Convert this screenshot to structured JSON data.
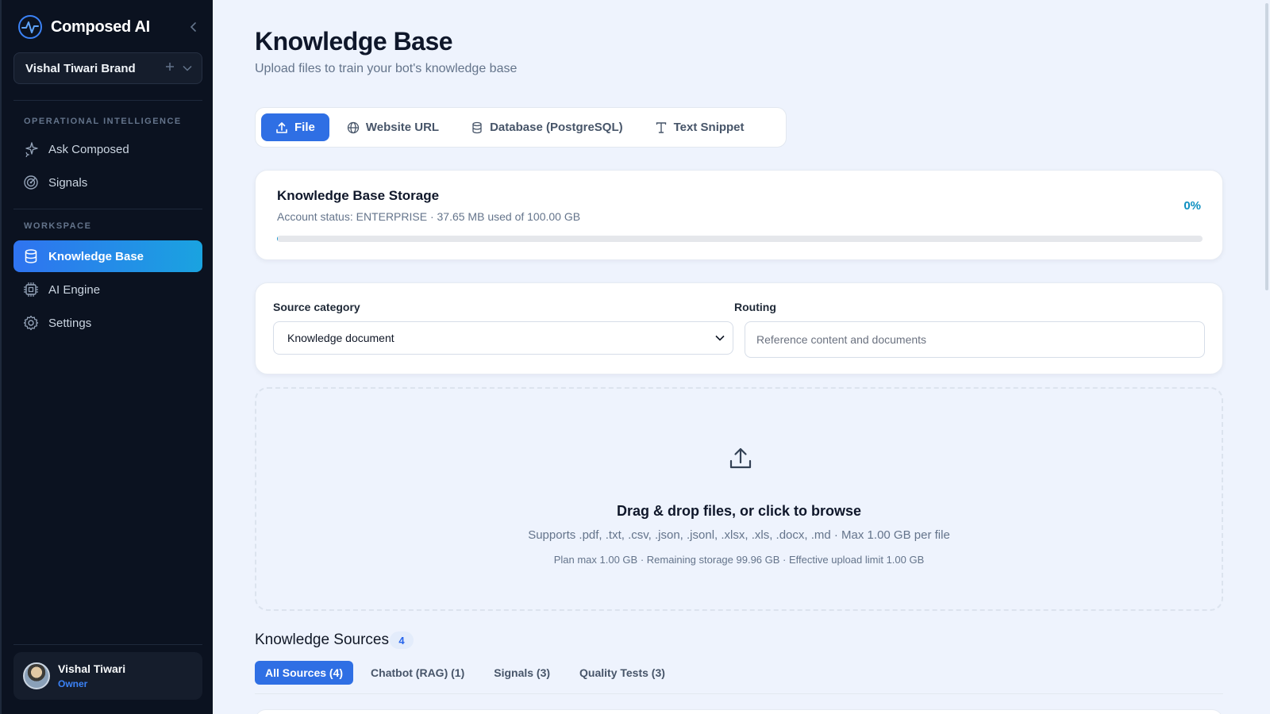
{
  "app": {
    "name": "Composed AI"
  },
  "brand_selector": {
    "label": "Vishal Tiwari Brand"
  },
  "sidebar": {
    "sections": [
      {
        "title": "OPERATIONAL INTELLIGENCE",
        "items": [
          {
            "label": "Ask Composed",
            "icon": "sparkles-icon"
          },
          {
            "label": "Signals",
            "icon": "radar-icon"
          }
        ]
      },
      {
        "title": "WORKSPACE",
        "items": [
          {
            "label": "Knowledge Base",
            "icon": "database-icon",
            "active": true
          },
          {
            "label": "AI Engine",
            "icon": "cpu-icon"
          },
          {
            "label": "Settings",
            "icon": "gear-icon"
          }
        ]
      }
    ],
    "user": {
      "name": "Vishal Tiwari",
      "role": "Owner"
    }
  },
  "page": {
    "title": "Knowledge Base",
    "subtitle": "Upload files to train your bot's knowledge base"
  },
  "tabs": [
    {
      "label": "File",
      "icon": "upload-icon",
      "active": true
    },
    {
      "label": "Website URL",
      "icon": "globe-icon"
    },
    {
      "label": "Database (PostgreSQL)",
      "icon": "database-icon"
    },
    {
      "label": "Text Snippet",
      "icon": "text-icon"
    }
  ],
  "storage": {
    "title": "Knowledge Base Storage",
    "status": "Account status: ENTERPRISE · 37.65 MB used of 100.00 GB",
    "percent_label": "0%",
    "used_fraction": 0.0004
  },
  "source": {
    "category_label": "Source category",
    "category_value": "Knowledge document",
    "routing_label": "Routing",
    "routing_placeholder": "Reference content and documents"
  },
  "dropzone": {
    "title": "Drag & drop files, or click to browse",
    "supports": "Supports .pdf, .txt, .csv, .json, .jsonl, .xlsx, .xls, .docx, .md · Max 1.00 GB per file",
    "limits": "Plan max 1.00 GB · Remaining storage 99.96 GB · Effective upload limit 1.00 GB"
  },
  "knowledge_sources": {
    "title": "Knowledge Sources",
    "count": "4",
    "filters": [
      {
        "label": "All Sources (4)",
        "active": true
      },
      {
        "label": "Chatbot (RAG) (1)"
      },
      {
        "label": "Signals (3)"
      },
      {
        "label": "Quality Tests (3)"
      }
    ]
  },
  "colors": {
    "accent": "#2f6fe4",
    "sidebar_bg": "#0b1220",
    "active_nav_gradient_end": "#1aa3e0",
    "page_bg": "#eef3fd"
  }
}
